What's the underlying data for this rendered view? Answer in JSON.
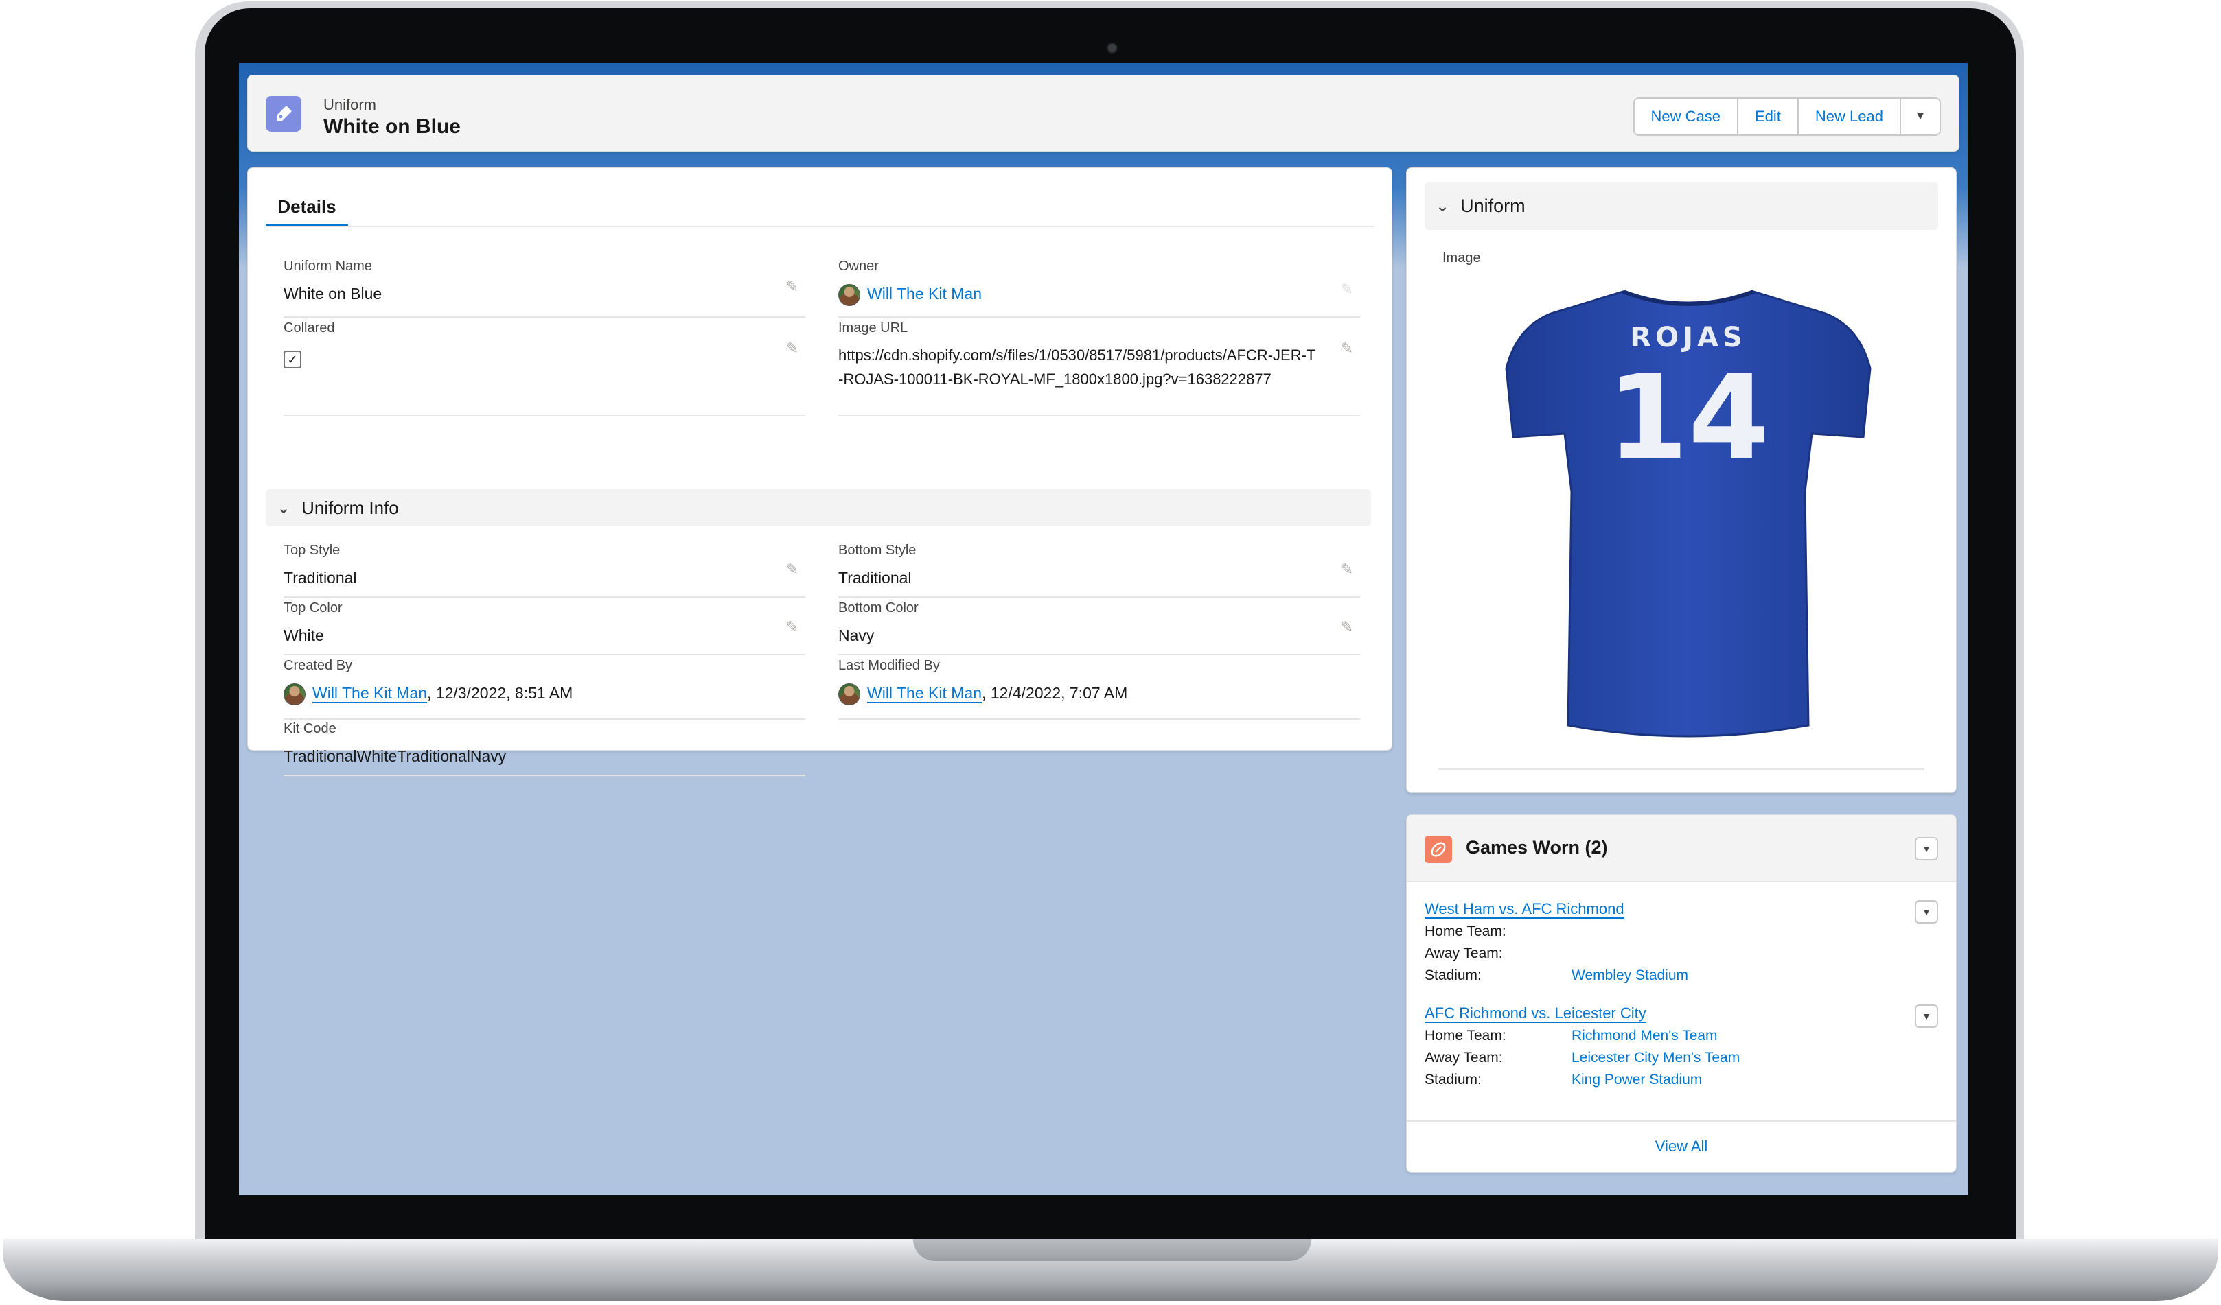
{
  "header": {
    "object_label": "Uniform",
    "record_title": "White on Blue",
    "actions": [
      "New Case",
      "Edit",
      "New Lead"
    ],
    "menu_glyph": "▼"
  },
  "tabs": {
    "details": "Details"
  },
  "details": {
    "uniform_name": {
      "label": "Uniform Name",
      "value": "White on Blue"
    },
    "owner": {
      "label": "Owner",
      "value": "Will The Kit Man"
    },
    "collared": {
      "label": "Collared",
      "checked_glyph": "✓"
    },
    "image_url": {
      "label": "Image URL",
      "value": "https://cdn.shopify.com/s/files/1/0530/8517/5981/products/AFCR-JER-T-ROJAS-100011-BK-ROYAL-MF_1800x1800.jpg?v=1638222877"
    }
  },
  "uniform_info": {
    "section_title": "Uniform Info",
    "top_style": {
      "label": "Top Style",
      "value": "Traditional"
    },
    "bottom_style": {
      "label": "Bottom Style",
      "value": "Traditional"
    },
    "top_color": {
      "label": "Top Color",
      "value": "White"
    },
    "bottom_color": {
      "label": "Bottom Color",
      "value": "Navy"
    },
    "created_by": {
      "label": "Created By",
      "user": "Will The Kit Man",
      "date": ", 12/3/2022, 8:51 AM"
    },
    "last_modified_by": {
      "label": "Last Modified By",
      "user": "Will The Kit Man",
      "date": ", 12/4/2022, 7:07 AM"
    },
    "kit_code": {
      "label": "Kit Code",
      "value": "TraditionalWhiteTraditionalNavy"
    }
  },
  "uniform_panel": {
    "section_title": "Uniform",
    "image_label": "Image",
    "jersey_name": "ROJAS",
    "jersey_number": "14"
  },
  "games_worn": {
    "title": "Games Worn (2)",
    "games": [
      {
        "title": "West Ham vs. AFC Richmond",
        "home_label": "Home Team:",
        "home": "",
        "away_label": "Away Team:",
        "away": "",
        "stadium_label": "Stadium:",
        "stadium": "Wembley Stadium"
      },
      {
        "title": "AFC Richmond vs. Leicester City",
        "home_label": "Home Team:",
        "home": "Richmond Men's Team",
        "away_label": "Away Team:",
        "away": "Leicester City Men's Team",
        "stadium_label": "Stadium:",
        "stadium": "King Power Stadium"
      }
    ],
    "view_all": "View All"
  },
  "colors": {
    "brand_blue": "#0176d3",
    "background": "#b0c4df",
    "object_icon": "#7f8de1",
    "games_icon": "#f38061",
    "jersey": "#2847a8"
  },
  "icons": {
    "object": "uniform-icon",
    "games": "football-icon",
    "edit": "pencil-icon",
    "collapse": "chevron-down-icon"
  }
}
